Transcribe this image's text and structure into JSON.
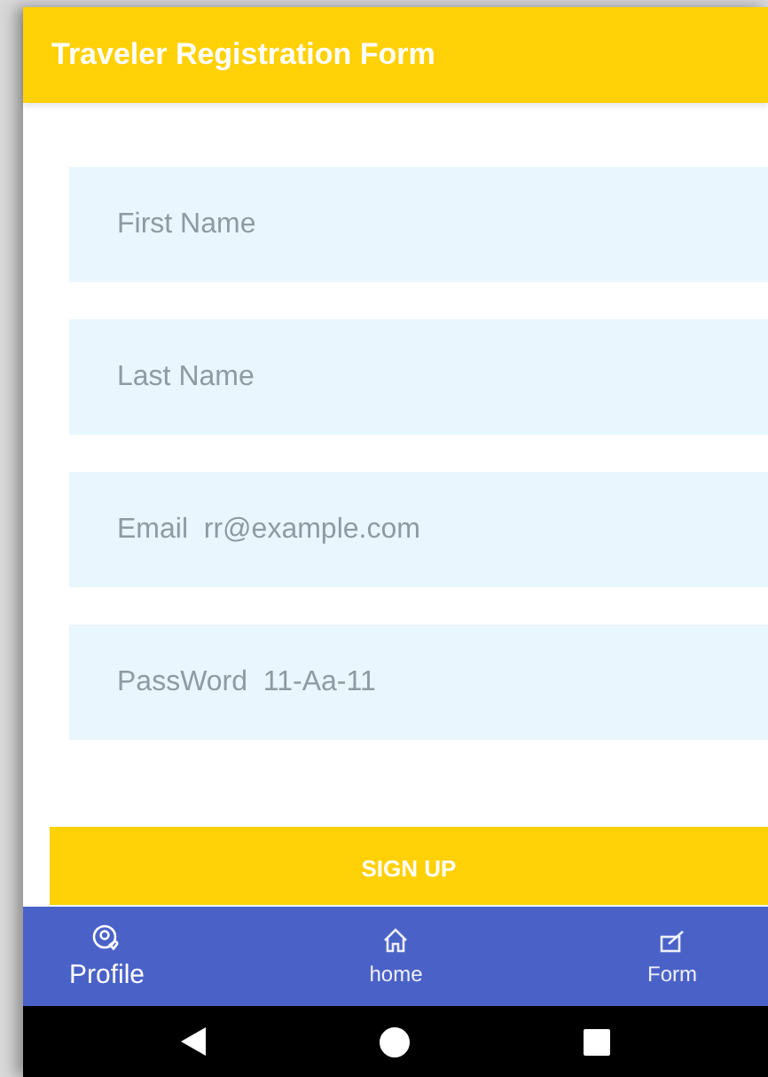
{
  "header": {
    "title": "Traveler Registration Form"
  },
  "fields": [
    {
      "placeholder": "First Name"
    },
    {
      "placeholder": "Last Name"
    },
    {
      "placeholder": "Email  rr@example.com"
    },
    {
      "placeholder": "PassWord  11-Aa-11"
    }
  ],
  "submit": {
    "label": "SIGN UP"
  },
  "bottom_nav": [
    {
      "label": "Profile",
      "kind": "profile",
      "selected": true
    },
    {
      "label": "home",
      "kind": "home",
      "selected": false
    },
    {
      "label": "Form",
      "kind": "form",
      "selected": false
    }
  ]
}
